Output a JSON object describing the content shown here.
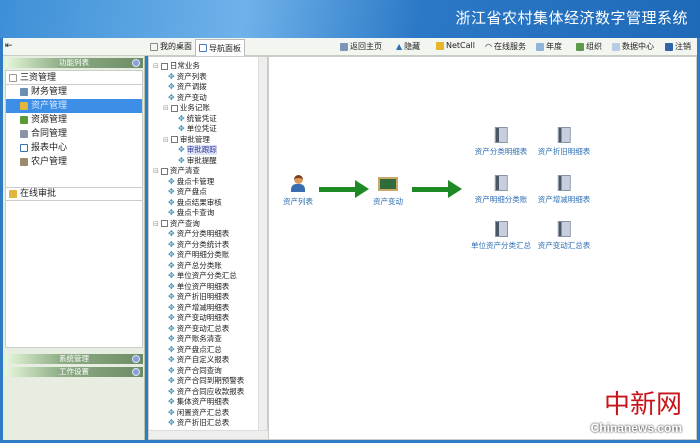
{
  "app_title": "浙江省农村集体经济数字管理系统",
  "tabs": [
    "我的桌面",
    "导航面板"
  ],
  "toolbar": [
    "返回主页",
    "隐藏",
    "NetCall",
    "在线服务",
    "年度",
    "组织",
    "数据中心",
    "注销"
  ],
  "left": {
    "group_function": "功能列表",
    "menu": [
      "三资管理",
      "财务管理",
      "资产管理",
      "资源管理",
      "合同管理",
      "报表中心",
      "农户管理"
    ],
    "online": "在线审批",
    "group_system": "系统管理",
    "group_work": "工作设置"
  },
  "tree": {
    "daily": "日常业务",
    "daily_items": [
      "资产列表",
      "资产调拨",
      "资产变动"
    ],
    "bookkeeping": "业务记账",
    "bookkeeping_items": [
      "统管凭证",
      "单位凭证"
    ],
    "approval": "审批管理",
    "approval_items": [
      "审批跟踪",
      "审批提醒"
    ],
    "inventory": "资产清查",
    "inventory_items": [
      "盘点卡管理",
      "资产盘点",
      "盘点结果审核",
      "盘点卡查询"
    ],
    "query": "资产查询",
    "query_items": [
      "资产分类明细表",
      "资产分类统计表",
      "资产明细分类账",
      "资产总分类账",
      "单位资产分类汇总",
      "单位资产明细表",
      "资产折旧明细表",
      "资产增减明细表",
      "资产变动明细表",
      "资产变动汇总表",
      "资产账务清查",
      "资产盘点汇总",
      "资产自定义报表",
      "资产合同查询",
      "资产合同到期预警表",
      "资产合同应收款报表",
      "集体资产明细表",
      "闲置资产汇总表",
      "资产折旧汇总表"
    ]
  },
  "flow": {
    "start": "资产列表",
    "middle": "资产变动",
    "reports": [
      "资产分类明细表",
      "资产折旧明细表",
      "资产明细分类账",
      "资产增减明细表",
      "单位资产分类汇总",
      "资产变动汇总表"
    ]
  },
  "watermark": {
    "cn": "中新网",
    "en": "Chinanews.com"
  }
}
